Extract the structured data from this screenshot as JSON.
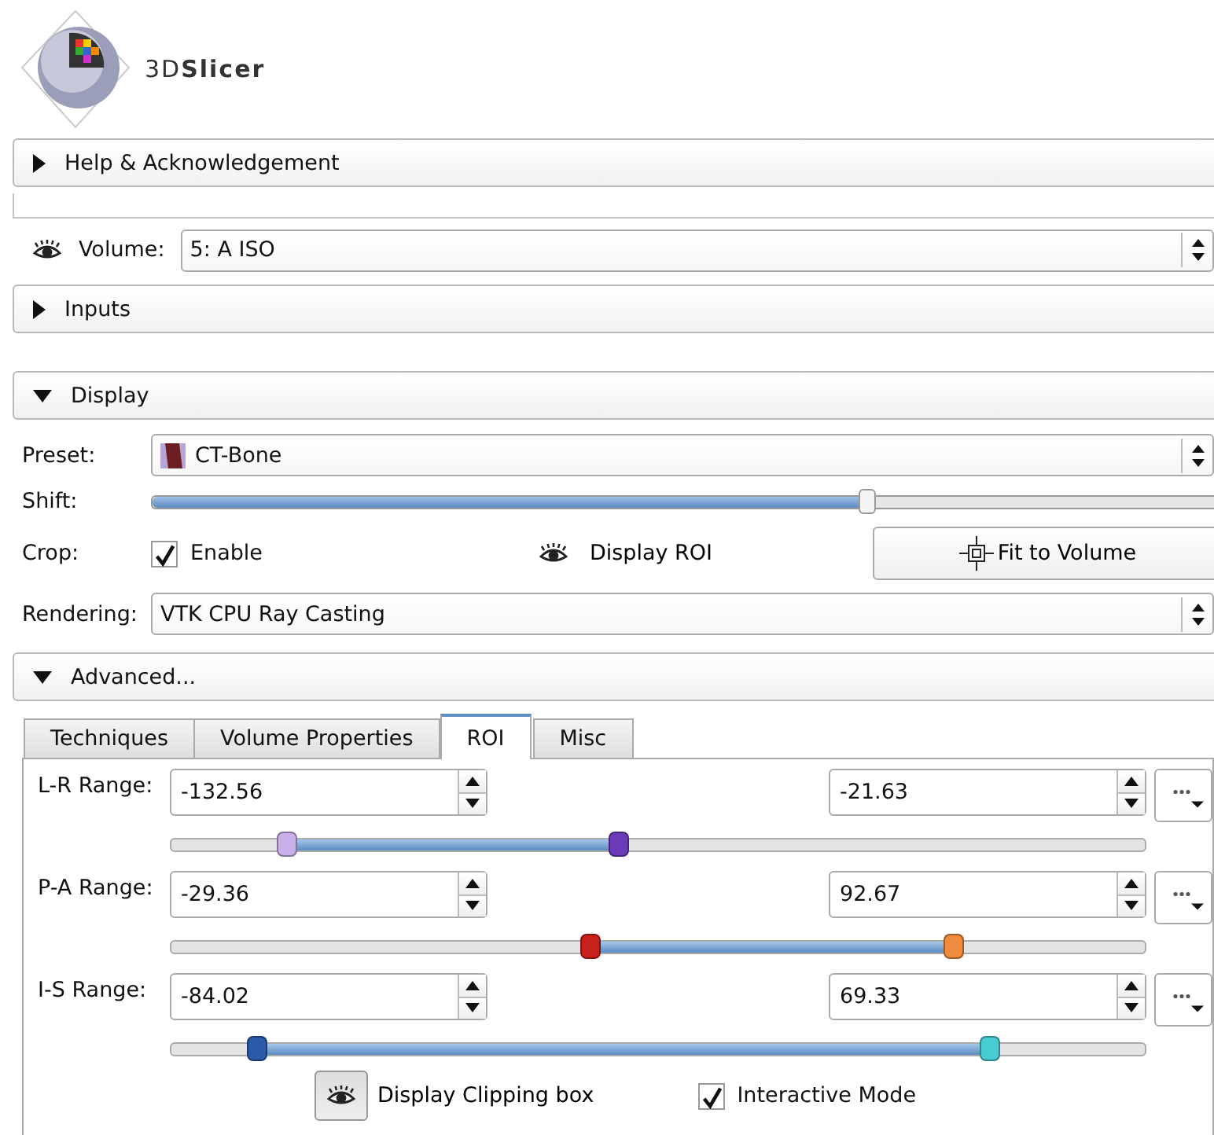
{
  "logo": {
    "text": "3D**Slicer**"
  },
  "help_section": {
    "title": "Help & Acknowledgement",
    "expanded": false
  },
  "volume": {
    "label": "Volume:",
    "value": "5: A ISO"
  },
  "inputs_section": {
    "title": "Inputs",
    "expanded": false
  },
  "display_section": {
    "title": "Display",
    "expanded": true,
    "preset": {
      "label": "Preset:",
      "value": "CT-Bone"
    },
    "shift": {
      "label": "Shift:",
      "level": 0.52
    },
    "crop": {
      "label": "Crop:",
      "enable": {
        "label": "Enable",
        "checked": true
      },
      "display_roi": {
        "label": "Display ROI",
        "pressed": false
      },
      "fit_button": "Fit to Volume"
    },
    "rendering": {
      "label": "Rendering:",
      "value": "VTK CPU Ray Casting"
    }
  },
  "advanced_section": {
    "title": "Advanced...",
    "expanded": true,
    "tabs": [
      {
        "label": "Techniques",
        "selected": false
      },
      {
        "label": "Volume Properties",
        "selected": false
      },
      {
        "label": "ROI",
        "selected": true
      },
      {
        "label": "Misc",
        "selected": false
      }
    ],
    "ranges": [
      {
        "label": "L-R Range:",
        "min": "-132.56",
        "max": "-21.63",
        "thumbs": [
          {
            "level": 0.118,
            "color": "#c9b0e8"
          },
          {
            "level": 0.458,
            "color": "#6a3ab8"
          }
        ]
      },
      {
        "label": "P-A Range:",
        "min": "-29.36",
        "max": "92.67",
        "thumbs": [
          {
            "level": 0.43,
            "color": "#c8201a"
          },
          {
            "level": 0.803,
            "color": "#f08a3c"
          }
        ]
      },
      {
        "label": "I-S Range:",
        "min": "-84.02",
        "max": "69.33",
        "thumbs": [
          {
            "level": 0.087,
            "color": "#2a5aa8"
          },
          {
            "level": 0.84,
            "color": "#48ccd4"
          }
        ]
      }
    ],
    "display_clipping_box": {
      "label": "Display Clipping box",
      "pressed": true
    },
    "interactive_mode": {
      "label": "Interactive Mode",
      "checked": true
    }
  }
}
